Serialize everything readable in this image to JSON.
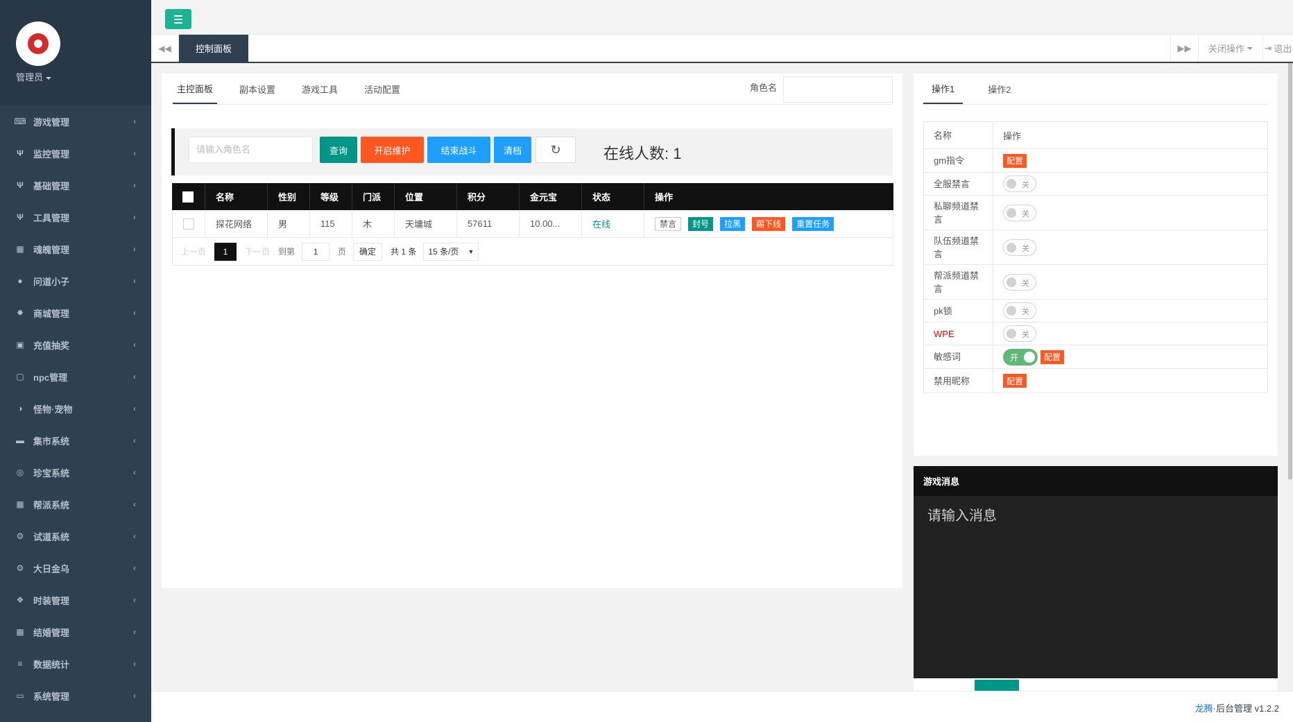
{
  "sidebar": {
    "admin_label": "管理员",
    "items": [
      {
        "label": "游戏管理",
        "icon": "gamepad-icon",
        "glyph": "⌨"
      },
      {
        "label": "监控管理",
        "icon": "cutlery-icon",
        "glyph": "Ψ"
      },
      {
        "label": "基础管理",
        "icon": "cutlery-icon",
        "glyph": "Ψ"
      },
      {
        "label": "工具管理",
        "icon": "cutlery-icon",
        "glyph": "Ψ"
      },
      {
        "label": "魂魄管理",
        "icon": "table-icon",
        "glyph": "▦"
      },
      {
        "label": "问道小子",
        "icon": "user-icon",
        "glyph": "●"
      },
      {
        "label": "商城管理",
        "icon": "gear-icon",
        "glyph": "✸"
      },
      {
        "label": "充值抽奖",
        "icon": "money-icon",
        "glyph": "▣"
      },
      {
        "label": "npc管理",
        "icon": "square-icon",
        "glyph": "▢"
      },
      {
        "label": "怪物·宠物",
        "icon": "adjust-icon",
        "glyph": "◑"
      },
      {
        "label": "集市系统",
        "icon": "bed-icon",
        "glyph": "▬"
      },
      {
        "label": "珍宝系统",
        "icon": "dot-circle-icon",
        "glyph": "◎"
      },
      {
        "label": "帮派系统",
        "icon": "table-icon",
        "glyph": "▦"
      },
      {
        "label": "试道系统",
        "icon": "gears-icon",
        "glyph": "⚙"
      },
      {
        "label": "大日金乌",
        "icon": "gears-icon",
        "glyph": "⚙"
      },
      {
        "label": "时装管理",
        "icon": "cubes-icon",
        "glyph": "❖"
      },
      {
        "label": "结婚管理",
        "icon": "book-icon",
        "glyph": "▩"
      },
      {
        "label": "数据统计",
        "icon": "database-icon",
        "glyph": "≡"
      },
      {
        "label": "系统管理",
        "icon": "desktop-icon",
        "glyph": "▭"
      }
    ]
  },
  "tabs": {
    "active_label": "控制面板",
    "close_ops_label": "关闭操作",
    "logout_label": "退出"
  },
  "main": {
    "subtabs": [
      "主控面板",
      "副本设置",
      "游戏工具",
      "活动配置"
    ],
    "role_label": "角色名",
    "toolbar": {
      "search_placeholder": "请输入角色名",
      "query_label": "查询",
      "maintain_label": "开启维护",
      "end_battle_label": "结束战斗",
      "clear_label": "清档",
      "online_text": "在线人数: 1"
    },
    "grid": {
      "headers": [
        "名称",
        "性别",
        "等级",
        "门派",
        "位置",
        "积分",
        "金元宝",
        "状态",
        "操作"
      ],
      "rows": [
        {
          "name": "探花网络",
          "gender": "男",
          "level": "115",
          "school": "木",
          "location": "天墉城",
          "score": "57611",
          "gold": "10.00...",
          "status": "在线"
        }
      ],
      "row_actions": [
        "禁言",
        "封号",
        "拉黑",
        "踢下线",
        "重置任务"
      ]
    },
    "pager": {
      "prev": "上一页",
      "current": "1",
      "next": "下一页",
      "goto": "到第",
      "goto_value": "1",
      "page_unit": "页",
      "confirm": "确定",
      "total": "共 1 条",
      "per_page": "15 条/页"
    }
  },
  "right": {
    "subtabs": [
      "操作1",
      "操作2"
    ],
    "header": {
      "name": "名称",
      "op": "操作"
    },
    "rows": [
      {
        "name": "gm指令",
        "type": "config"
      },
      {
        "name": "全服禁言",
        "type": "off"
      },
      {
        "name": "私聊频道禁言",
        "type": "off"
      },
      {
        "name": "队伍频道禁言",
        "type": "off"
      },
      {
        "name": "帮派频道禁言",
        "type": "off"
      },
      {
        "name": "pk锁",
        "type": "off"
      },
      {
        "name": "WPE",
        "type": "off",
        "highlight": true
      },
      {
        "name": "敏感词",
        "type": "on_config"
      },
      {
        "name": "禁用昵称",
        "type": "config"
      }
    ],
    "config_label": "配置",
    "off_label": "关",
    "on_label": "开"
  },
  "message": {
    "title": "游戏消息",
    "placeholder": "请输入消息"
  },
  "footer": {
    "brand": "龙腾",
    "text": "·后台管理 v1.2.2"
  }
}
